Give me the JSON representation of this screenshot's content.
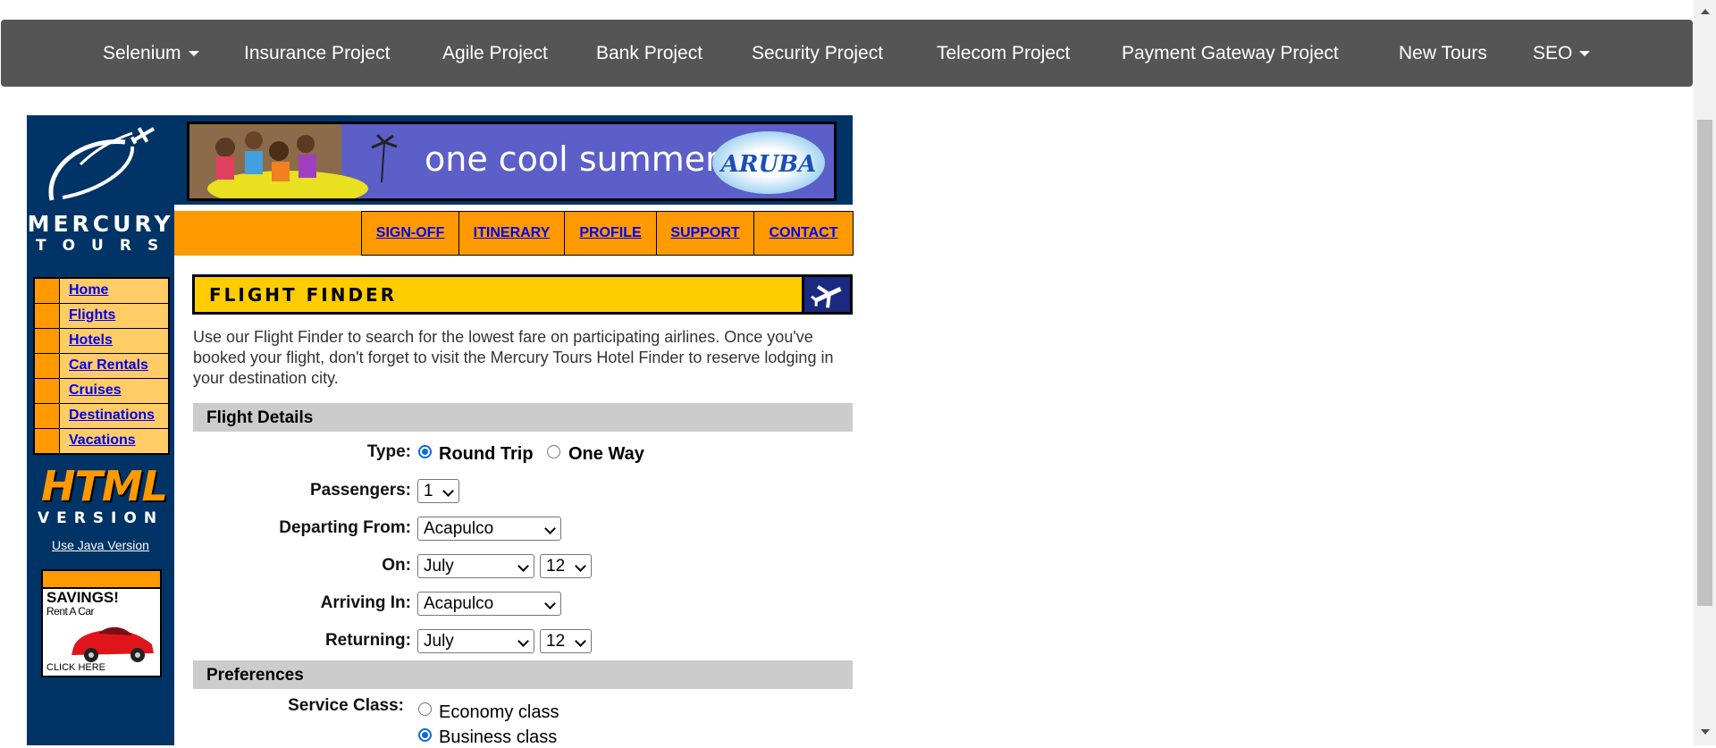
{
  "topnav": {
    "items": [
      {
        "label": "Selenium",
        "dropdown": true
      },
      {
        "label": "Insurance Project"
      },
      {
        "label": "Agile Project"
      },
      {
        "label": "Bank Project"
      },
      {
        "label": "Security Project"
      },
      {
        "label": "Telecom Project"
      },
      {
        "label": "Payment Gateway Project"
      },
      {
        "label": "New Tours"
      },
      {
        "label": "SEO",
        "dropdown": true
      }
    ]
  },
  "sidebar": {
    "logo_line1": "MERCURY",
    "logo_line2": "TOURS",
    "menu": [
      "Home",
      "Flights",
      "Hotels",
      "Car Rentals",
      "Cruises",
      "Destinations",
      "Vacations"
    ],
    "html_version_big": "HTML",
    "html_version_small": "VERSION",
    "java_link": "Use Java Version",
    "ad": {
      "title": "SAVINGS!",
      "subtitle": "Rent A Car",
      "cta": "CLICK HERE"
    }
  },
  "banner": {
    "slogan": "one cool summer",
    "brand": "ARUBA"
  },
  "top_links": [
    "SIGN-OFF",
    "ITINERARY",
    "PROFILE",
    "SUPPORT",
    "CONTACT"
  ],
  "finder": {
    "title": "FLIGHT FINDER",
    "intro": "Use our Flight Finder to search for the lowest fare on participating airlines. Once you've booked your flight, don't forget to visit the Mercury Tours Hotel Finder to reserve lodging in your destination city."
  },
  "flight_details": {
    "header": "Flight Details",
    "type_label": "Type:",
    "type_options": [
      "Round Trip",
      "One Way"
    ],
    "type_selected": "Round Trip",
    "passengers_label": "Passengers:",
    "passengers_value": "1",
    "departing_label": "Departing From:",
    "departing_value": "Acapulco",
    "on_label": "On:",
    "on_month": "July",
    "on_day": "12",
    "arriving_label": "Arriving In:",
    "arriving_value": "Acapulco",
    "returning_label": "Returning:",
    "returning_month": "July",
    "returning_day": "12"
  },
  "preferences": {
    "header": "Preferences",
    "service_label": "Service Class:",
    "service_options": [
      "Economy class",
      "Business class"
    ],
    "service_selected": "Business class"
  },
  "colors": {
    "navbar": "#555555",
    "sidebar": "#003366",
    "orange": "#ff9900",
    "header_yellow": "#ffcc00",
    "link": "#0000ee"
  }
}
